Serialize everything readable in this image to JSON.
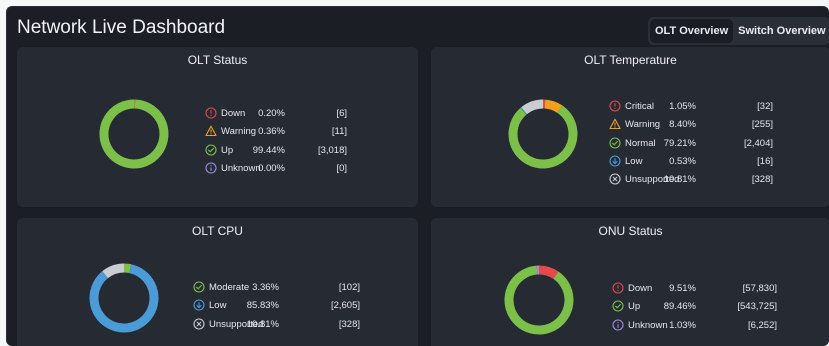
{
  "header": {
    "title": "Network Live Dashboard"
  },
  "tabs": [
    {
      "label": "OLT Overview",
      "active": true
    },
    {
      "label": "Switch Overview",
      "active": false
    }
  ],
  "colors": {
    "red": "#e5484d",
    "orange": "#f0a020",
    "green": "#7cc04a",
    "blue": "#4a9bd6",
    "purple": "#a18be6",
    "gray": "#c9ccd1"
  },
  "panels": {
    "olt_status": {
      "title": "OLT Status",
      "rows": [
        {
          "icon": "error-circle-icon",
          "label": "Down",
          "pct": "0.20%",
          "count": "[6]",
          "value": 0.2,
          "color": "#e5484d"
        },
        {
          "icon": "warning-triangle-icon",
          "label": "Warning",
          "pct": "0.36%",
          "count": "[11]",
          "value": 0.36,
          "color": "#f0a020"
        },
        {
          "icon": "check-circle-icon",
          "label": "Up",
          "pct": "99.44%",
          "count": "[3,018]",
          "value": 99.44,
          "color": "#7cc04a"
        },
        {
          "icon": "info-circle-icon",
          "label": "Unknown",
          "pct": "0.00%",
          "count": "[0]",
          "value": 0.0,
          "color": "#a18be6"
        }
      ]
    },
    "olt_temperature": {
      "title": "OLT Temperature",
      "rows": [
        {
          "icon": "error-circle-icon",
          "label": "Critical",
          "pct": "1.05%",
          "count": "[32]",
          "value": 1.05,
          "color": "#e5484d"
        },
        {
          "icon": "warning-triangle-icon",
          "label": "Warning",
          "pct": "8.40%",
          "count": "[255]",
          "value": 8.4,
          "color": "#f0a020"
        },
        {
          "icon": "check-circle-icon",
          "label": "Normal",
          "pct": "79.21%",
          "count": "[2,404]",
          "value": 79.21,
          "color": "#7cc04a"
        },
        {
          "icon": "arrow-down-circle-icon",
          "label": "Low",
          "pct": "0.53%",
          "count": "[16]",
          "value": 0.53,
          "color": "#4a9bd6"
        },
        {
          "icon": "x-circle-icon",
          "label": "Unsupported",
          "pct": "10.81%",
          "count": "[328]",
          "value": 10.81,
          "color": "#c9ccd1"
        }
      ]
    },
    "olt_cpu": {
      "title": "OLT CPU",
      "rows": [
        {
          "icon": "check-circle-icon",
          "label": "Moderate",
          "pct": "3.36%",
          "count": "[102]",
          "value": 3.36,
          "color": "#7cc04a"
        },
        {
          "icon": "arrow-down-circle-icon",
          "label": "Low",
          "pct": "85.83%",
          "count": "[2,605]",
          "value": 85.83,
          "color": "#4a9bd6"
        },
        {
          "icon": "x-circle-icon",
          "label": "Unsupported",
          "pct": "10.81%",
          "count": "[328]",
          "value": 10.81,
          "color": "#c9ccd1"
        }
      ]
    },
    "onu_status": {
      "title": "ONU Status",
      "rows": [
        {
          "icon": "error-circle-icon",
          "label": "Down",
          "pct": "9.51%",
          "count": "[57,830]",
          "value": 9.51,
          "color": "#e5484d"
        },
        {
          "icon": "check-circle-icon",
          "label": "Up",
          "pct": "89.46%",
          "count": "[543,725]",
          "value": 89.46,
          "color": "#7cc04a"
        },
        {
          "icon": "info-circle-icon",
          "label": "Unknown",
          "pct": "1.03%",
          "count": "[6,252]",
          "value": 1.03,
          "color": "#a18be6"
        }
      ]
    }
  }
}
